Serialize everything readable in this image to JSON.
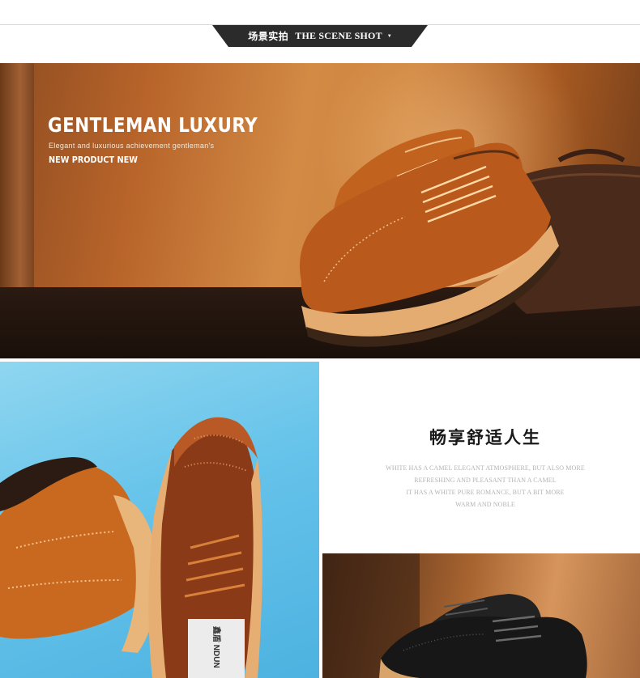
{
  "header": {
    "label_cn": "场景实拍",
    "label_en": "THE SCENE SHOT",
    "arrow": "▼"
  },
  "banner": {
    "title": "GENTLEMAN LUXURY",
    "subtitle": "Elegant and luxurious achievement gentleman's",
    "tag": "NEW PRODUCT NEW"
  },
  "slogan": {
    "heading": "畅享舒适人生",
    "lines": [
      "WHITE HAS A CAMEL ELEGANT ATMOSPHERE, BUT ALSO MORE",
      "REFRESHING AND PLEASANT THAN A CAMEL",
      "IT HAS A WHITE PURE ROMANCE, BUT A BIT MORE",
      "WARM AND NOBLE"
    ]
  },
  "photos": {
    "left_brand_text": "鑫盾 NDUN"
  },
  "colors": {
    "header_tab": "#2b2b2b",
    "banner_leather": "#b8642a",
    "sky_blue": "#66c3ea",
    "shoe_tan": "#c8692a",
    "shoe_black": "#1c1c1c"
  }
}
